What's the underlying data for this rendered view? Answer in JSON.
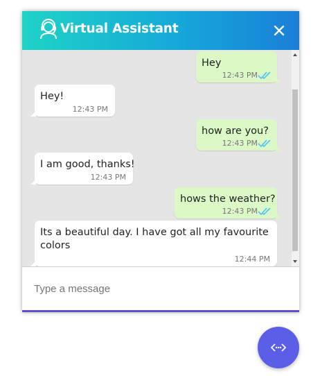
{
  "header": {
    "title": "Virtual Assistant",
    "icon": "support-agent-icon",
    "close_icon": "close-icon"
  },
  "messages": [
    {
      "sender": "user",
      "text": "Hey",
      "time": "12:43 PM",
      "status": "read"
    },
    {
      "sender": "bot",
      "text": "Hey!",
      "time": "12:43 PM"
    },
    {
      "sender": "user",
      "text": "how are you?",
      "time": "12:43 PM",
      "status": "read"
    },
    {
      "sender": "bot",
      "text": "I am good, thanks!",
      "time": "12:43 PM"
    },
    {
      "sender": "user",
      "text": "hows the weather?",
      "time": "12:43 PM",
      "status": "read"
    },
    {
      "sender": "bot",
      "text": "Its a beautiful day. I have got all my favourite colors",
      "time": "12:44 PM"
    }
  ],
  "input": {
    "placeholder": "Type a message",
    "value": ""
  },
  "launcher": {
    "icon": "code-arrows-icon"
  },
  "colors": {
    "header_gradient_start": "#1fd3c6",
    "header_gradient_end": "#1a7fd8",
    "user_bubble": "#dcf8c6",
    "bot_bubble": "#ffffff",
    "chat_background": "#e5e5e5",
    "read_ticks": "#4fc3f7",
    "launcher": "#5b5ee6"
  }
}
